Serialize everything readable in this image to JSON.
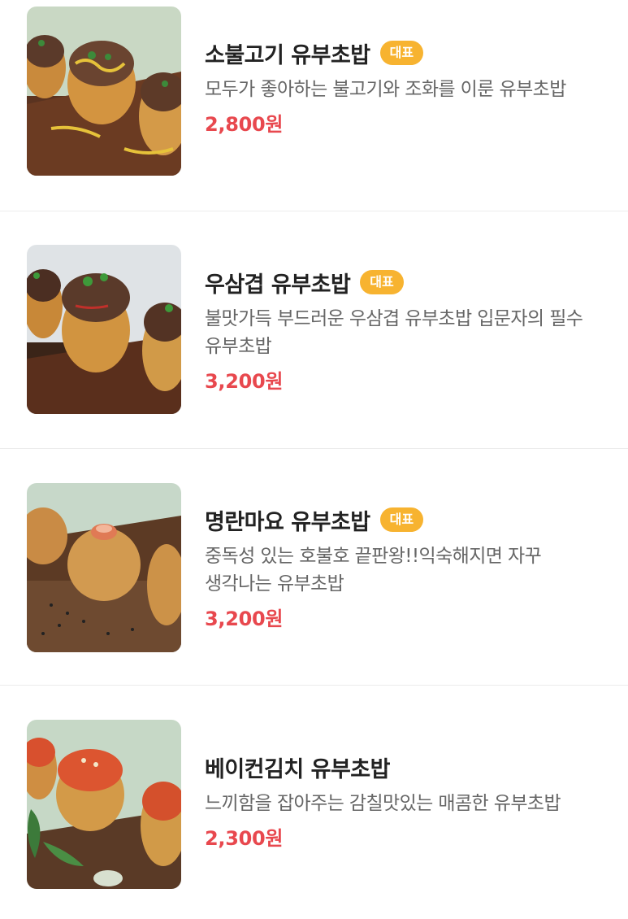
{
  "menu": {
    "items": [
      {
        "name": "소불고기 유부초밥",
        "badge": "대표",
        "description": "모두가 좋아하는 불고기와 조화를 이룬 유부초밥",
        "price": "2,800원",
        "image_icon": "bulgogi-yubu-sushi-photo"
      },
      {
        "name": "우삼겹 유부초밥",
        "badge": "대표",
        "description": "불맛가득 부드러운 우삼겹 유부초밥 입문자의 필수 유부초밥",
        "price": "3,200원",
        "image_icon": "beef-brisket-yubu-sushi-photo"
      },
      {
        "name": "명란마요 유부초밥",
        "badge": "대표",
        "description": "중독성 있는 호불호 끝판왕!!익숙해지면 자꾸 생각나는 유부초밥",
        "price": "3,200원",
        "image_icon": "pollock-roe-mayo-yubu-sushi-photo"
      },
      {
        "name": "베이컨김치 유부초밥",
        "badge": "",
        "description": "느끼함을 잡아주는 감칠맛있는 매콤한 유부초밥",
        "price": "2,300원",
        "image_icon": "bacon-kimchi-yubu-sushi-photo"
      }
    ]
  },
  "colors": {
    "badge": "#f7b330",
    "price": "#e8484e",
    "title": "#222222",
    "description": "#666666",
    "divider": "#ececec"
  }
}
